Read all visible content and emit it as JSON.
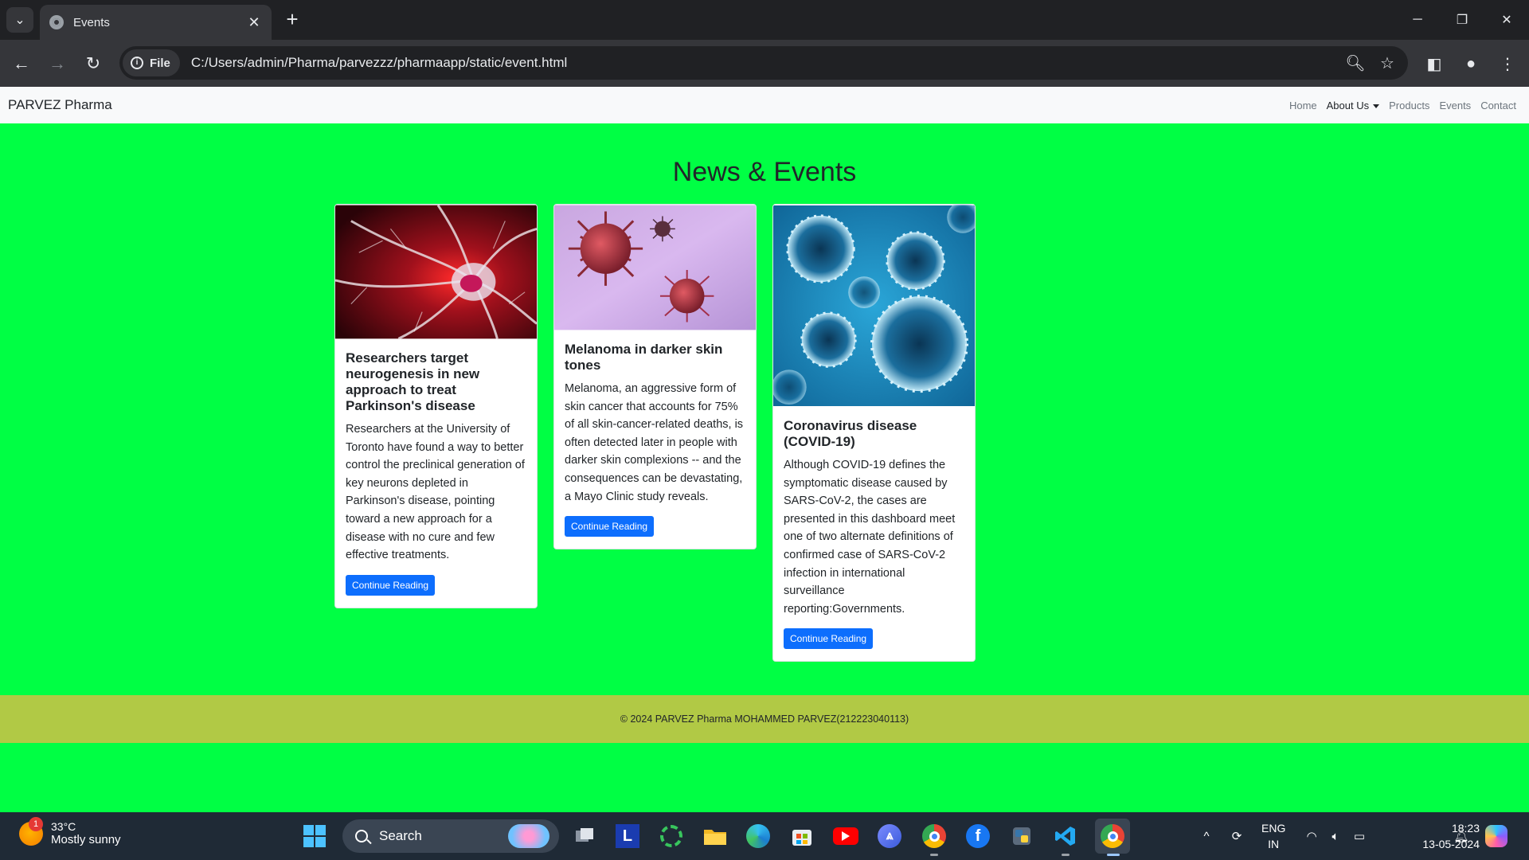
{
  "browser": {
    "tab_title": "Events",
    "chip_label": "File",
    "url": "C:/Users/admin/Pharma/parvezzz/pharmaapp/static/event.html"
  },
  "site": {
    "brand": "PARVEZ Pharma",
    "nav": [
      {
        "label": "Home"
      },
      {
        "label": "About Us"
      },
      {
        "label": "Products"
      },
      {
        "label": "Events"
      },
      {
        "label": "Contact"
      }
    ],
    "heading": "News & Events",
    "cards": [
      {
        "title": "Researchers target neurogenesis in new approach to treat Parkinson's disease",
        "text": "Researchers at the University of Toronto have found a way to better control the preclinical generation of key neurons depleted in Parkinson's disease, pointing toward a new approach for a disease with no cure and few effective treatments.",
        "button": "Continue Reading",
        "image": "neuron-image"
      },
      {
        "title": "Melanoma in darker skin tones",
        "text": "Melanoma, an aggressive form of skin cancer that accounts for 75% of all skin-cancer-related deaths, is often detected later in people with darker skin complexions -- and the consequences can be devastating, a Mayo Clinic study reveals.",
        "button": "Continue Reading",
        "image": "virus-image"
      },
      {
        "title": "Coronavirus disease (COVID-19)",
        "text": "Although COVID-19 defines the symptomatic disease caused by SARS-CoV-2, the cases are presented in this dashboard meet one of two alternate definitions of confirmed case of SARS-CoV-2 infection in international surveillance reporting:Governments.",
        "button": "Continue Reading",
        "image": "coronavirus-image"
      }
    ],
    "footer": "© 2024 PARVEZ Pharma MOHAMMED PARVEZ(212223040113)",
    "colors": {
      "page_bg": "#00ff44",
      "footer_bg": "#b1c945",
      "button": "#0d6efd"
    }
  },
  "taskbar": {
    "weather_badge": "1",
    "temperature": "33°C",
    "weather_desc": "Mostly sunny",
    "search_placeholder": "Search",
    "lang_line1": "ENG",
    "lang_line2": "IN",
    "time": "18:23",
    "date": "13-05-2024"
  }
}
